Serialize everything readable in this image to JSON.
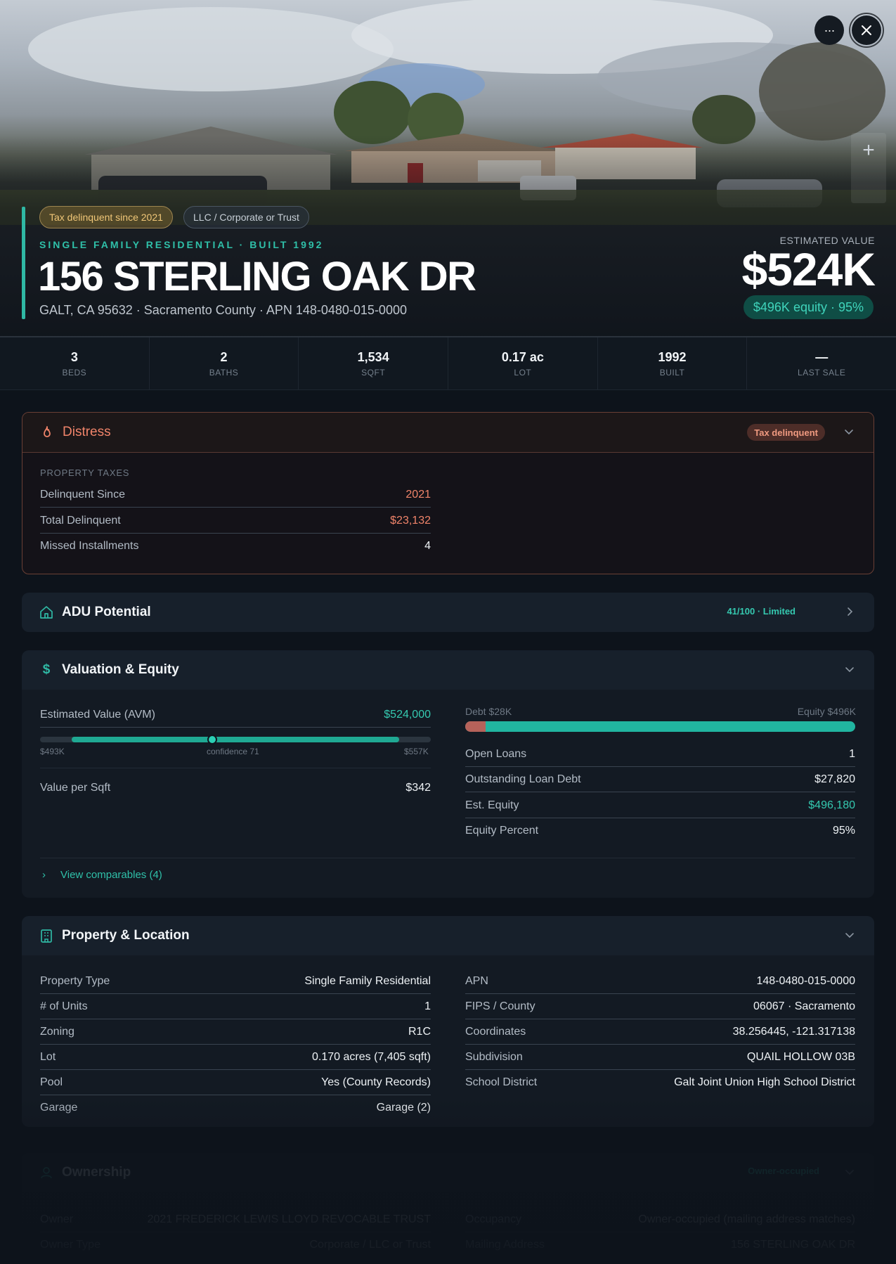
{
  "hero": {
    "badges": {
      "tax": "Tax delinquent since 2021",
      "owner_type": "LLC / Corporate or Trust"
    },
    "subtitle": "SINGLE FAMILY RESIDENTIAL · BUILT 1992",
    "address": "156 STERLING OAK DR",
    "location": "GALT, CA 95632 · Sacramento County · APN 148-0480-015-0000",
    "estimated_value_label": "ESTIMATED VALUE",
    "estimated_value": "$524K",
    "equity_pill": "$496K equity · 95%",
    "buttons": {
      "more": "···",
      "close": "✕",
      "zoom_in": "+"
    }
  },
  "stats": [
    {
      "value": "3",
      "label": "BEDS"
    },
    {
      "value": "2",
      "label": "BATHS"
    },
    {
      "value": "1,534",
      "label": "SQFT"
    },
    {
      "value": "0.17 ac",
      "label": "LOT"
    },
    {
      "value": "1992",
      "label": "BUILT"
    },
    {
      "value": "—",
      "label": "LAST SALE"
    }
  ],
  "distress": {
    "title": "Distress",
    "tag": "Tax delinquent",
    "section": "PROPERTY TAXES",
    "rows": [
      {
        "k": "Delinquent Since",
        "v": "2021"
      },
      {
        "k": "Total Delinquent",
        "v": "$23,132"
      },
      {
        "k": "Missed Installments",
        "v": "4"
      }
    ]
  },
  "adu": {
    "title": "ADU Potential",
    "tag": "41/100 · Limited"
  },
  "valuation": {
    "title": "Valuation & Equity",
    "avm_label": "Estimated Value (AVM)",
    "avm_value": "$524,000",
    "avm_low": "$493K",
    "avm_confidence": "confidence 71",
    "avm_high": "$557K",
    "value_per_sqft_label": "Value per Sqft",
    "value_per_sqft": "$342",
    "debt_label": "Debt $28K",
    "equity_label": "Equity $496K",
    "debt_fraction": 0.053,
    "rows": [
      {
        "k": "Open Loans",
        "v": "1"
      },
      {
        "k": "Outstanding Loan Debt",
        "v": "$27,820"
      },
      {
        "k": "Est. Equity",
        "v": "$496,180"
      },
      {
        "k": "Equity Percent",
        "v": "95%"
      }
    ],
    "view_comparables": "View comparables (4)"
  },
  "property": {
    "title": "Property & Location",
    "left": [
      {
        "k": "Property Type",
        "v": "Single Family Residential"
      },
      {
        "k": "# of Units",
        "v": "1"
      },
      {
        "k": "Zoning",
        "v": "R1C"
      },
      {
        "k": "Lot",
        "v": "0.170 acres (7,405 sqft)"
      },
      {
        "k": "Pool",
        "v": "Yes (County Records)"
      },
      {
        "k": "Garage",
        "v": "Garage (2)"
      }
    ],
    "right": [
      {
        "k": "APN",
        "v": "148-0480-015-0000"
      },
      {
        "k": "FIPS / County",
        "v": "06067 · Sacramento"
      },
      {
        "k": "Coordinates",
        "v": "38.256445, -121.317138"
      },
      {
        "k": "Subdivision",
        "v": "QUAIL HOLLOW 03B"
      },
      {
        "k": "School District",
        "v": "Galt Joint Union High School District"
      }
    ]
  },
  "ownership": {
    "title": "Ownership",
    "tag": "Owner-occupied",
    "left": [
      {
        "k": "Owner",
        "v": "2021 FREDERICK LEWIS LLOYD REVOCABLE TRUST"
      },
      {
        "k": "Owner Type",
        "v": "Corporate / LLC or Trust"
      }
    ],
    "right": [
      {
        "k": "Occupancy",
        "v": "Owner-occupied (mailing address matches)"
      },
      {
        "k": "Mailing Address",
        "v": "156 STERLING OAK DR"
      }
    ]
  },
  "colors": {
    "accent": "#2fb8a4",
    "distress": "#f0846a",
    "background": "#0d131b"
  }
}
